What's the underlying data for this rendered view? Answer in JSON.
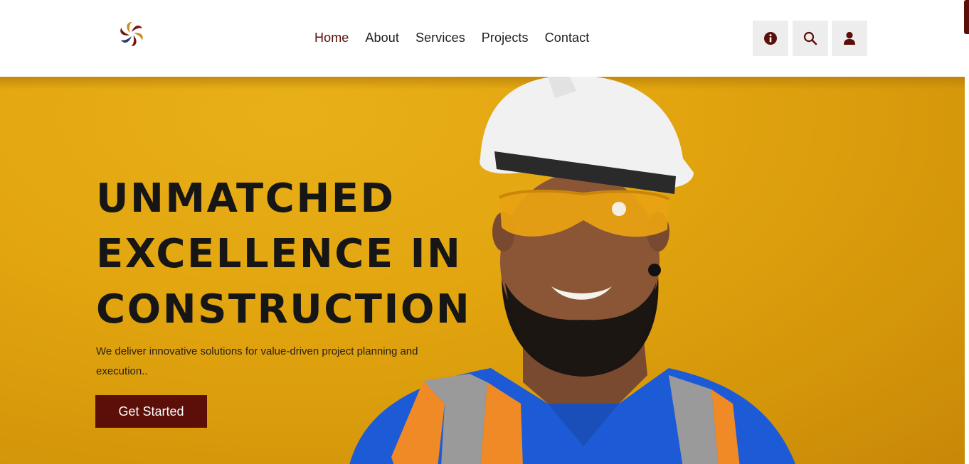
{
  "header": {
    "logo": {
      "icon": "pinwheel-logo-icon",
      "colors": [
        "#7a1410",
        "#c8902e",
        "#2f3a6b"
      ]
    },
    "nav": [
      {
        "label": "Home",
        "active": true
      },
      {
        "label": "About",
        "active": false
      },
      {
        "label": "Services",
        "active": false
      },
      {
        "label": "Projects",
        "active": false
      },
      {
        "label": "Contact",
        "active": false
      }
    ],
    "actions": [
      {
        "icon": "info-icon"
      },
      {
        "icon": "search-icon"
      },
      {
        "icon": "user-icon"
      }
    ]
  },
  "hero": {
    "title": "UNMATCHED\nEXCELLENCE IN\nCONSTRUCTION",
    "subtitle": "We deliver innovative solutions for value-driven project planning and execution..",
    "cta_label": "Get Started",
    "image": "construction-worker-photo"
  },
  "colors": {
    "accent": "#5c0e08",
    "hero_background": "#e2a50f",
    "icon_button_bg": "#ededed",
    "text_dark": "#161616"
  }
}
